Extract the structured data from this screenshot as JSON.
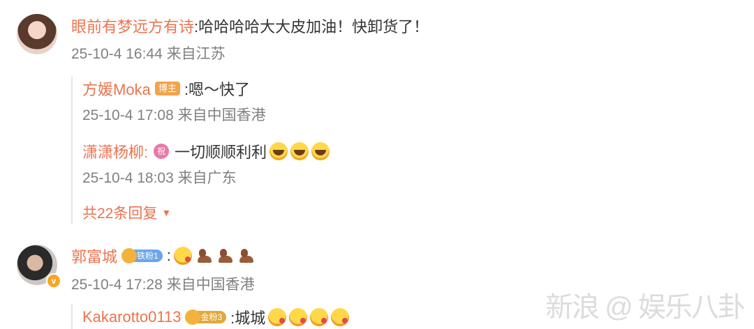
{
  "comments": [
    {
      "user": "眼前有梦远方有诗",
      "text": ":哈哈哈哈大大皮加油！快卸货了！",
      "meta": "25-10-4 16:44 来自江苏",
      "replies": [
        {
          "user": "方媛Moka",
          "badge": "博主",
          "text": ":嗯～快了",
          "meta": "25-10-4 17:08 来自中国香港"
        },
        {
          "user": "潇潇杨柳:",
          "badge": "祝",
          "text": "一切顺顺利利",
          "meta": "25-10-4 18:03 来自广东"
        }
      ],
      "more_replies": "共22条回复"
    },
    {
      "user": "郭富城",
      "fan_badge": "铁粉1",
      "text": ":",
      "meta": "25-10-4 17:28 来自中国香港",
      "verified": "v",
      "replies": [
        {
          "user": "Kakarotto0113",
          "fan_badge": "金粉3",
          "text": ":城城"
        }
      ]
    }
  ],
  "watermark": "新浪 @ 娱乐八卦"
}
